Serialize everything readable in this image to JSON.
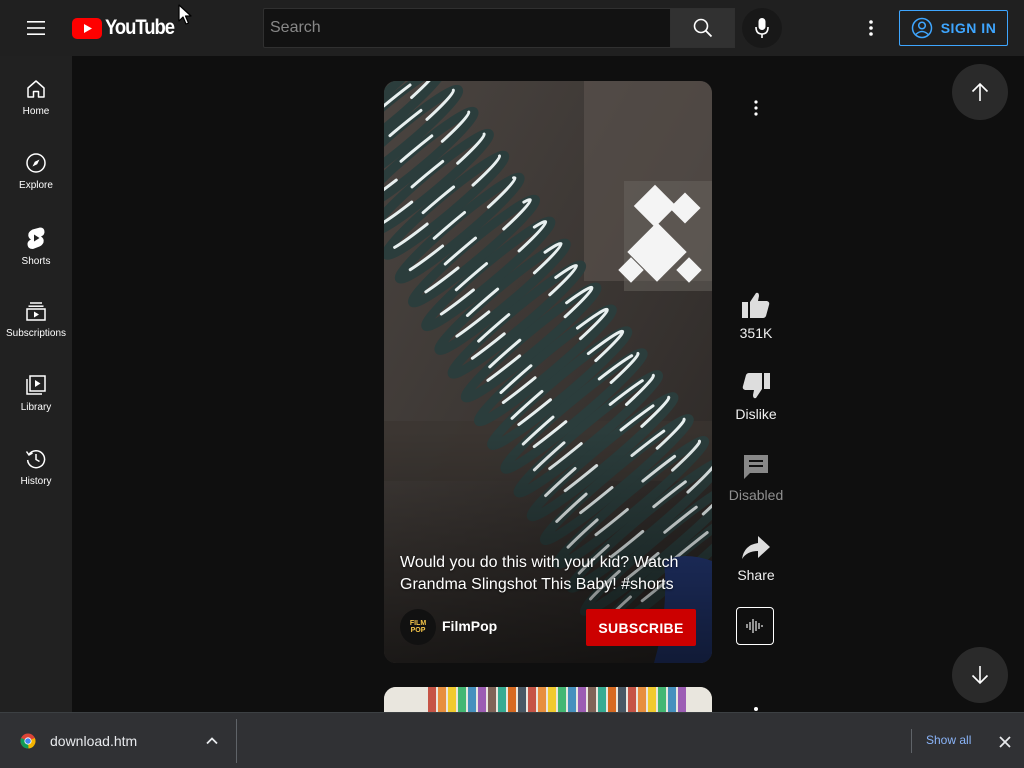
{
  "header": {
    "logo_text": "YouTube",
    "search_placeholder": "Search",
    "sign_in_label": "SIGN IN"
  },
  "sidebar": {
    "items": [
      {
        "label": "Home",
        "icon": "home-icon"
      },
      {
        "label": "Explore",
        "icon": "compass-icon"
      },
      {
        "label": "Shorts",
        "icon": "shorts-icon"
      },
      {
        "label": "Subscriptions",
        "icon": "subscriptions-icon"
      },
      {
        "label": "Library",
        "icon": "library-icon"
      },
      {
        "label": "History",
        "icon": "history-icon"
      }
    ]
  },
  "short": {
    "title": "Would you do this with your kid? Watch Grandma Slingshot This Baby! #shorts",
    "channel": {
      "name": "FilmPop",
      "avatar_text_top": "FILM",
      "avatar_text_bottom": "POP"
    },
    "subscribe_label": "SUBSCRIBE",
    "actions": {
      "like_count": "351K",
      "dislike_label": "Dislike",
      "comments_label": "Disabled",
      "share_label": "Share"
    }
  },
  "download_bar": {
    "filename": "download.htm",
    "show_all_label": "Show all"
  },
  "colors": {
    "brand_red": "#ff0000",
    "subscribe_red": "#cc0000",
    "link_blue": "#3ea6ff",
    "download_link": "#8ab4f8"
  }
}
